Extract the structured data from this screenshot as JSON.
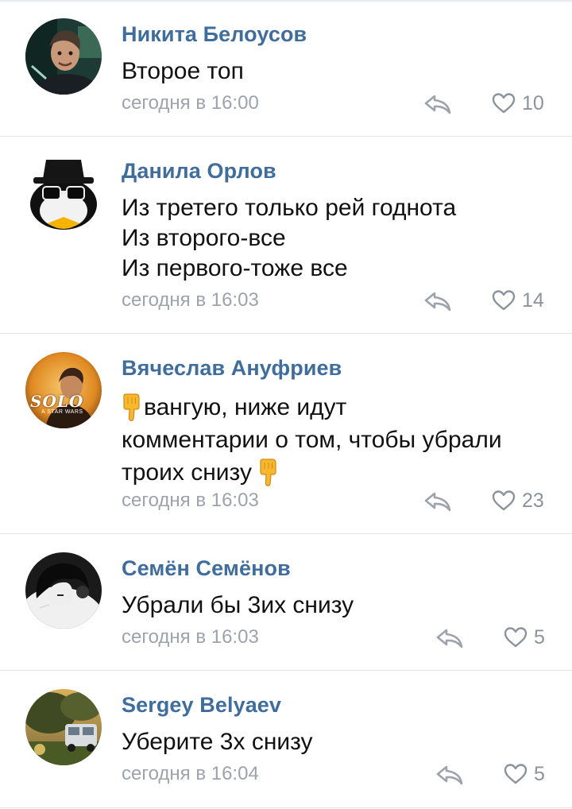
{
  "comments": [
    {
      "author": "Никита Белоусов",
      "lines": [
        "Второе топ"
      ],
      "time": "сегодня в 16:00",
      "likes": "10",
      "avatar_icon": "man-portrait"
    },
    {
      "author": "Данила Орлов",
      "lines": [
        "Из третего только рей годнота",
        "Из второго-все",
        "Из первого-тоже все"
      ],
      "time": "сегодня в 16:03",
      "likes": "14",
      "avatar_icon": "penguin-in-hat"
    },
    {
      "author": "Вячеслав Ануфриев",
      "lines": [
        "вангую, ниже идут",
        "комментарии о том, чтобы убрали",
        "троих снизу"
      ],
      "emoji": "backhand-index-pointing-down",
      "time": "сегодня в 16:03",
      "likes": "23",
      "avatar_icon": "solo-poster",
      "avatar_text": "SOLO",
      "avatar_subtext": "A STAR WARS"
    },
    {
      "author": "Семён Семёнов",
      "lines": [
        "Убрали бы 3их снизу"
      ],
      "time": "сегодня в 16:03",
      "likes": "5",
      "avatar_icon": "anime-headphones"
    },
    {
      "author": "Sergey Belyaev",
      "lines": [
        "Уберите 3х снизу"
      ],
      "time": "сегодня в 16:04",
      "likes": "5",
      "avatar_icon": "van-landscape"
    }
  ],
  "colors": {
    "author": "#3f6d9e",
    "text": "#111111",
    "meta": "#9ea3ab",
    "divider": "#e3e4e8"
  }
}
